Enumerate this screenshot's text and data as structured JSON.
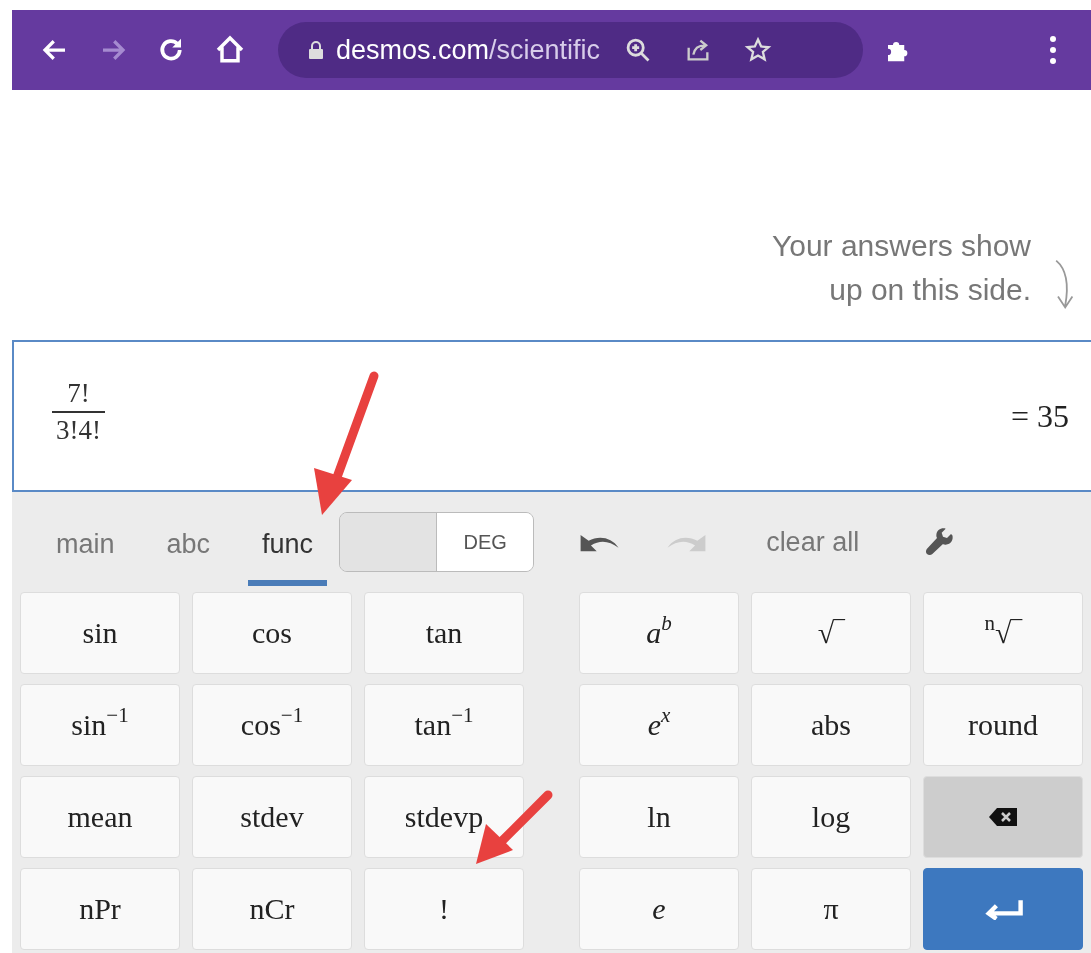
{
  "browser": {
    "nav": [
      {
        "kind": "back",
        "disabled": false
      },
      {
        "kind": "forward",
        "disabled": true
      },
      {
        "kind": "reload",
        "disabled": false
      },
      {
        "kind": "home",
        "disabled": false
      }
    ],
    "url": {
      "host": "desmos.com",
      "path": "/scientific"
    }
  },
  "hint": [
    "Your answers show",
    "up on this side."
  ],
  "expression": {
    "numerator": "7!",
    "denominator": "3!4!",
    "result": "= 35"
  },
  "tabs": [
    {
      "label": "main",
      "selected": false
    },
    {
      "label": "abc",
      "selected": false
    },
    {
      "label": "func",
      "selected": true
    }
  ],
  "angle_toggle": {
    "label": "DEG"
  },
  "undo": {
    "disabled": false
  },
  "redo": {
    "disabled": true
  },
  "clear_all": "clear all",
  "keys_left": [
    [
      {
        "kind": "plain",
        "label": "sin"
      },
      {
        "kind": "plain",
        "label": "cos"
      },
      {
        "kind": "plain",
        "label": "tan"
      }
    ],
    [
      {
        "kind": "plain",
        "label": "sin$^{−1}$"
      },
      {
        "kind": "plain",
        "label": "cos$^{−1}$"
      },
      {
        "kind": "plain",
        "label": "tan$^{−1}$"
      }
    ],
    [
      {
        "kind": "plain",
        "label": "mean"
      },
      {
        "kind": "plain",
        "label": "stdev"
      },
      {
        "kind": "plain",
        "label": "stdevp"
      }
    ],
    [
      {
        "kind": "plain",
        "label": "nPr"
      },
      {
        "kind": "plain",
        "label": "nCr"
      },
      {
        "kind": "plain",
        "label": "!"
      }
    ]
  ],
  "keys_right": [
    [
      {
        "kind": "italic",
        "label": "a$^{b}$"
      },
      {
        "kind": "plain",
        "label": "√‾"
      },
      {
        "kind": "plain",
        "label": "$^{n}$√‾"
      }
    ],
    [
      {
        "kind": "italic",
        "label": "e$^{x}$"
      },
      {
        "kind": "plain",
        "label": "abs"
      },
      {
        "kind": "plain",
        "label": "round"
      }
    ],
    [
      {
        "kind": "plain",
        "label": "ln"
      },
      {
        "kind": "plain",
        "label": "log"
      },
      {
        "kind": "backspace"
      }
    ],
    [
      {
        "kind": "italic",
        "label": "e"
      },
      {
        "kind": "plain",
        "label": "π"
      },
      {
        "kind": "enter"
      }
    ]
  ]
}
